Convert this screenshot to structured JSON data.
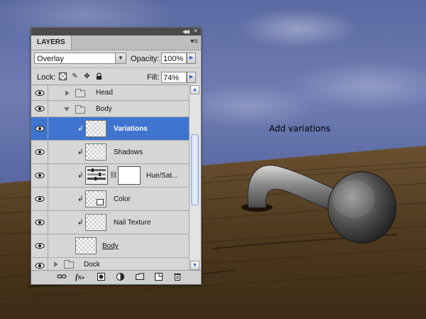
{
  "annotation": "Add variations",
  "panel": {
    "tab_label": "LAYERS",
    "blend_mode": "Overlay",
    "opacity_label": "Opacity:",
    "opacity_value": "100%",
    "lock_label": "Lock:",
    "fill_label": "Fill:",
    "fill_value": "74%",
    "layers": [
      {
        "name": "Head",
        "type": "group",
        "expanded": false
      },
      {
        "name": "Body",
        "type": "group",
        "expanded": true
      },
      {
        "name": "Variations",
        "type": "clipped",
        "selected": true
      },
      {
        "name": "Shadows",
        "type": "clipped"
      },
      {
        "name": "Hue/Sat...",
        "type": "adjustment"
      },
      {
        "name": "Color",
        "type": "clipped"
      },
      {
        "name": "Nail Texture",
        "type": "clipped"
      },
      {
        "name": "Body",
        "type": "base"
      },
      {
        "name": "Dock",
        "type": "group",
        "expanded": false
      }
    ]
  },
  "colors": {
    "selected_row": "#3f74cf",
    "panel_bg": "#d6d6d6",
    "sky": "#5b6aa2",
    "wood": "#5a4020"
  }
}
